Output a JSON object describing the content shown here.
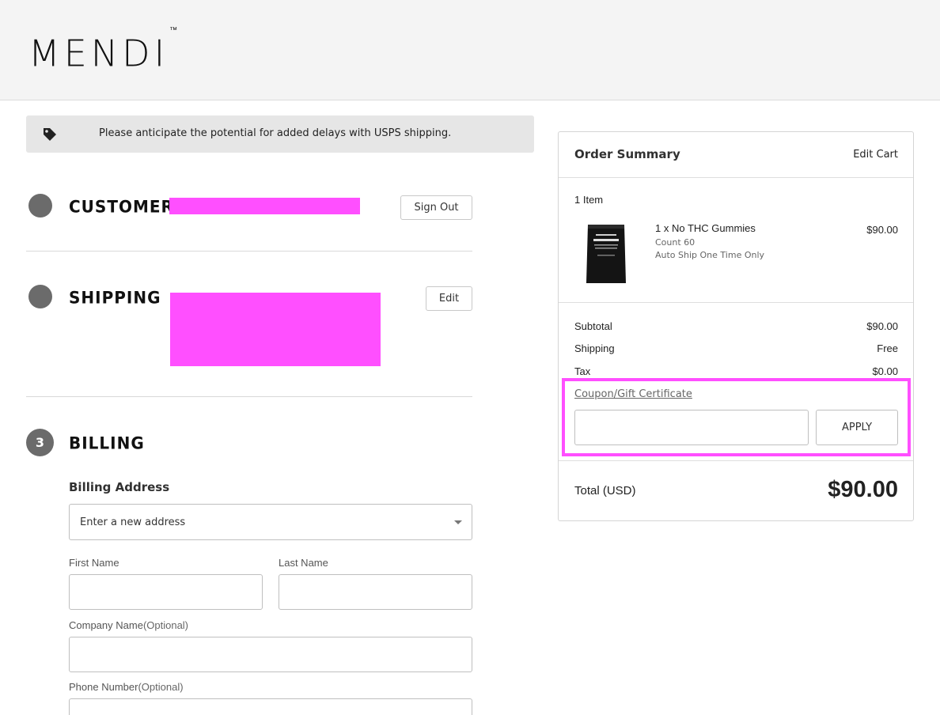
{
  "brand": {
    "name": "MENDI",
    "trademark": "™"
  },
  "notice": {
    "text": "Please anticipate the potential for added delays with USPS shipping.",
    "icon": "tag-icon"
  },
  "steps": {
    "customer": {
      "heading": "CUSTOMER",
      "button": "Sign Out"
    },
    "shipping": {
      "heading": "SHIPPING",
      "button": "Edit"
    },
    "billing": {
      "number": "3",
      "heading": "BILLING"
    }
  },
  "billing_form": {
    "section_title": "Billing Address",
    "address_select": "Enter a new address",
    "first_name_label": "First Name",
    "last_name_label": "Last Name",
    "company_label": "Company Name",
    "company_optional": "(Optional)",
    "phone_label": "Phone Number",
    "phone_optional": "(Optional)"
  },
  "order_summary": {
    "title": "Order Summary",
    "edit_cart": "Edit Cart",
    "item_count": "1 Item",
    "product": {
      "name": "1 x No THC Gummies",
      "count": "Count 60",
      "shipping_option": "Auto Ship One Time Only",
      "price": "$90.00"
    },
    "subtotal_label": "Subtotal",
    "subtotal_value": "$90.00",
    "shipping_label": "Shipping",
    "shipping_value": "Free",
    "tax_label": "Tax",
    "tax_value": "$0.00",
    "coupon_link": "Coupon/Gift Certificate",
    "apply_label": "APPLY",
    "total_label": "Total (USD)",
    "total_value": "$90.00"
  },
  "colors": {
    "redaction": "#ff4fff",
    "step_circle": "#6b6b6b",
    "header_bg": "#f4f4f4"
  }
}
